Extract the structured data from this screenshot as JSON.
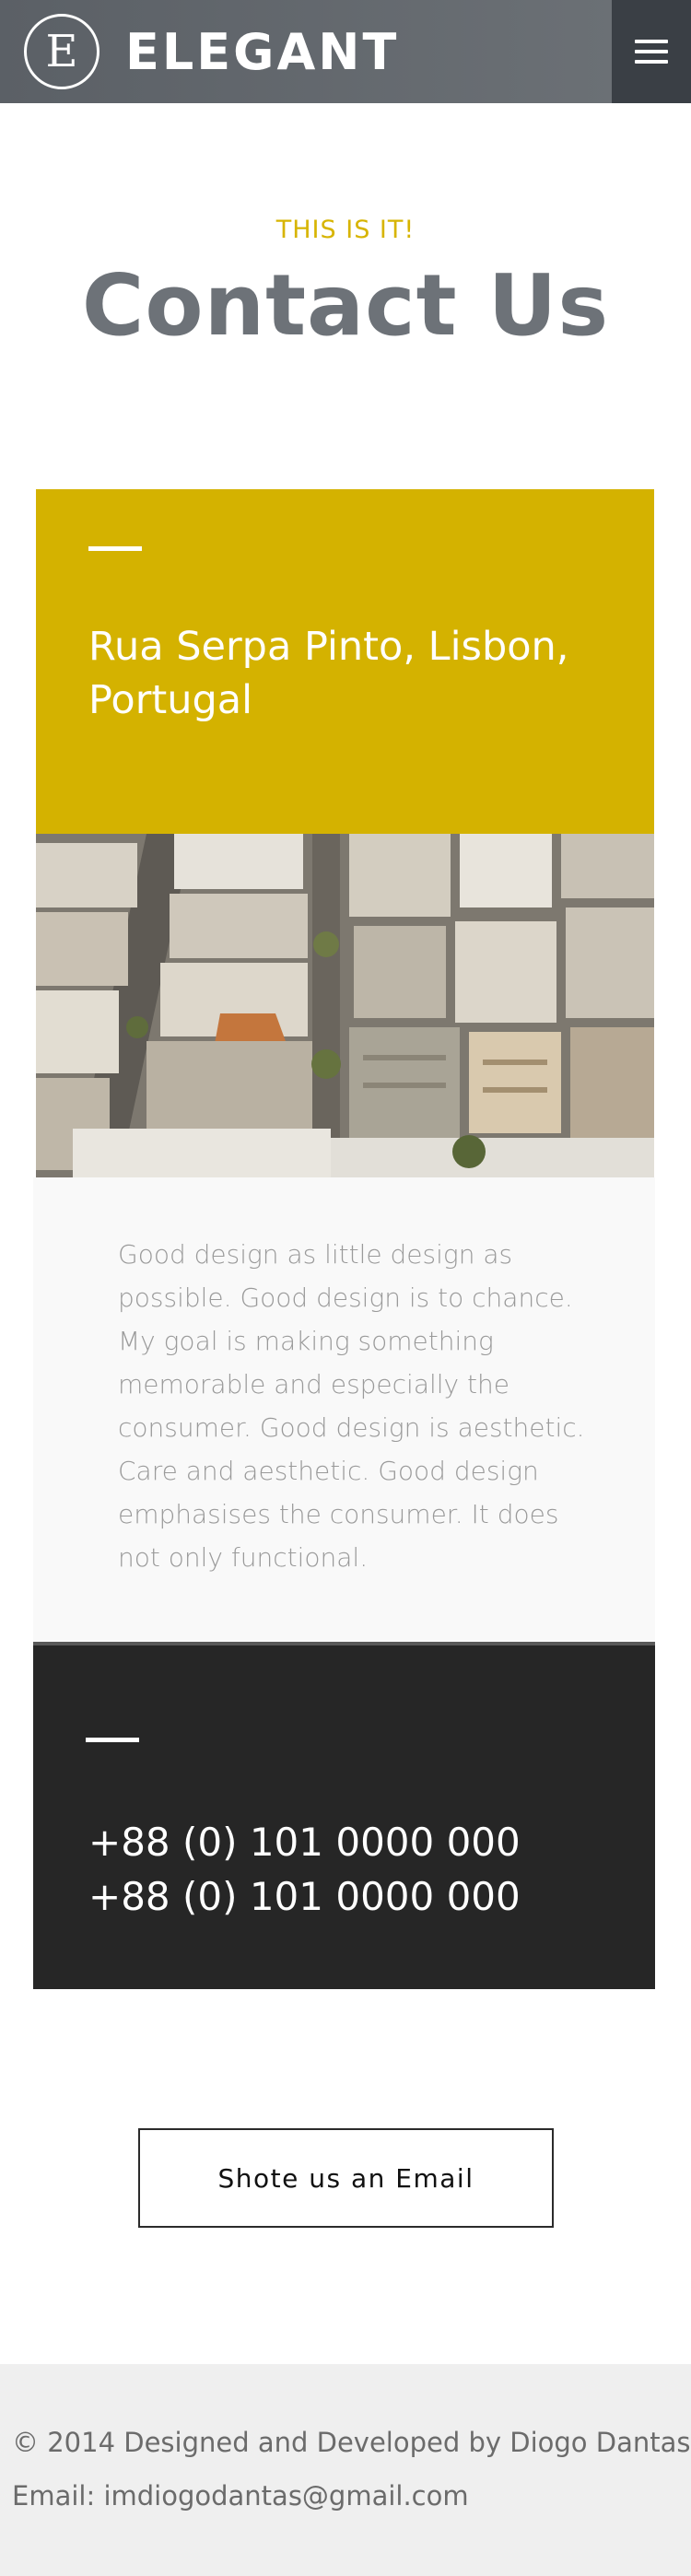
{
  "header": {
    "logo_letter": "E",
    "logo_text": "ELEGANT",
    "menu_icon": "hamburger-menu-icon"
  },
  "hero": {
    "kicker": "THIS IS IT!",
    "title": "Contact Us"
  },
  "address": {
    "text": "Rua Serpa Pinto, Lisbon, Portugal"
  },
  "image": {
    "subject": "aerial-city-rooftops"
  },
  "description": {
    "text": "Good design as little design as possible. Good design is to chance. My goal is making something memorable and especially the consumer. Good design is aesthetic. Care and aesthetic. Good design emphasises the consumer. It does not only functional."
  },
  "phones": {
    "line1": "+88 (0) 101 0000 000",
    "line2": "+88 (0) 101 0000 000"
  },
  "cta": {
    "email_button_label": "Shote us an Email"
  },
  "footer": {
    "copyright": "© 2014 Designed and Developed by Diogo Dantas",
    "email": "Email: imdiogodantas@gmail.com"
  },
  "colors": {
    "accent_yellow": "#d4b200",
    "header_gray": "#5b6066",
    "dark_block": "#262626",
    "footer_bg": "#efefef"
  }
}
